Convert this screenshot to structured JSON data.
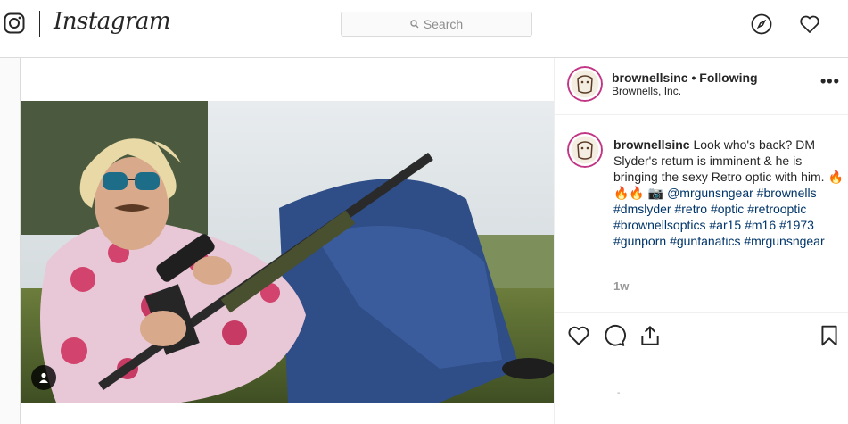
{
  "brand": {
    "wordmark": "Instagram",
    "logo_icon": "instagram-glyph-icon"
  },
  "search": {
    "placeholder": "Search",
    "icon": "search-icon"
  },
  "nav": {
    "explore_icon": "compass-icon",
    "activity_icon": "heart-icon"
  },
  "post": {
    "author": {
      "username": "brownellsinc",
      "separator": "•",
      "follow_status": "Following",
      "full_name": "Brownells, Inc."
    },
    "more_label": "•••",
    "caption": {
      "username": "brownellsinc",
      "text": "Look who's back? DM Slyder's return is imminent & he is bringing the sexy Retro optic with him.",
      "emoji": "🔥 🔥🔥 📷",
      "mention": "@mrgunsngear",
      "hashtags": [
        "#brownells",
        "#dmslyder",
        "#retro",
        "#optic",
        "#retrooptic",
        "#brownellsoptics",
        "#ar15",
        "#m16",
        "#1973",
        "#gunporn",
        "#gunfanatics",
        "#mrgunsngear"
      ]
    },
    "timestamp": "1w",
    "footer_mark": "-",
    "actions": [
      "heart-icon",
      "comment-icon",
      "share-icon",
      "bookmark-icon"
    ],
    "media": {
      "description_icon": "user-tag-icon"
    }
  },
  "colors": {
    "link": "#003569",
    "border": "#dbdbdb",
    "text": "#262626",
    "muted": "#999999"
  }
}
